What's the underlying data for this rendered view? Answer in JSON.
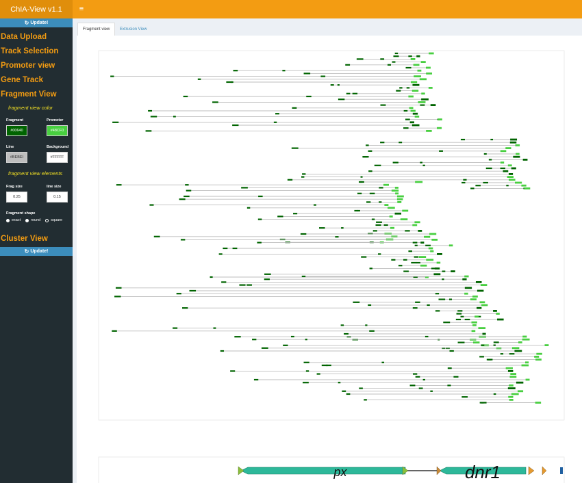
{
  "app": {
    "title": "ChIA-View v1.1"
  },
  "toolbar": {
    "menu_icon": "bars-icon",
    "menu_glyph": "≡"
  },
  "sidebar": {
    "update_label": "Update!",
    "refresh_glyph": "↻",
    "menu": [
      "Data Upload",
      "Track Selection",
      "Promoter view",
      "Gene Track",
      "Fragment View"
    ],
    "color_section_title": "fragment view color",
    "fields": {
      "fragment": {
        "label": "Fragment",
        "value": "#00640"
      },
      "promoter": {
        "label": "Promoter",
        "value": "#48CF0"
      },
      "line": {
        "label": "Line",
        "value": "#BEBEI"
      },
      "background": {
        "label": "Background",
        "value": "#FFFFF"
      },
      "frag_size": {
        "label": "Frag size",
        "value": "0.25"
      },
      "line_size": {
        "label": "line size",
        "value": "0.15"
      }
    },
    "elements_section_title": "fragment view elements",
    "shape_label": "Fragment shape",
    "shape_options": [
      "exact",
      "round",
      "square"
    ],
    "cluster_view": "Cluster View"
  },
  "tabs": {
    "fragment_view": "Fragment view",
    "extrusion_view": "Extrusion View"
  },
  "colors": {
    "header_orange": "#f39c12",
    "sidebar_dark": "#222d32",
    "update_blue": "#3c8dbc",
    "fragment_dark_green": "#006400",
    "promoter_green": "#48cf40",
    "line_gray": "#bebebe",
    "gene_teal": "#2db89a"
  },
  "gene_track": {
    "genes": [
      {
        "name": "px"
      },
      {
        "name": "dnr1"
      }
    ]
  }
}
